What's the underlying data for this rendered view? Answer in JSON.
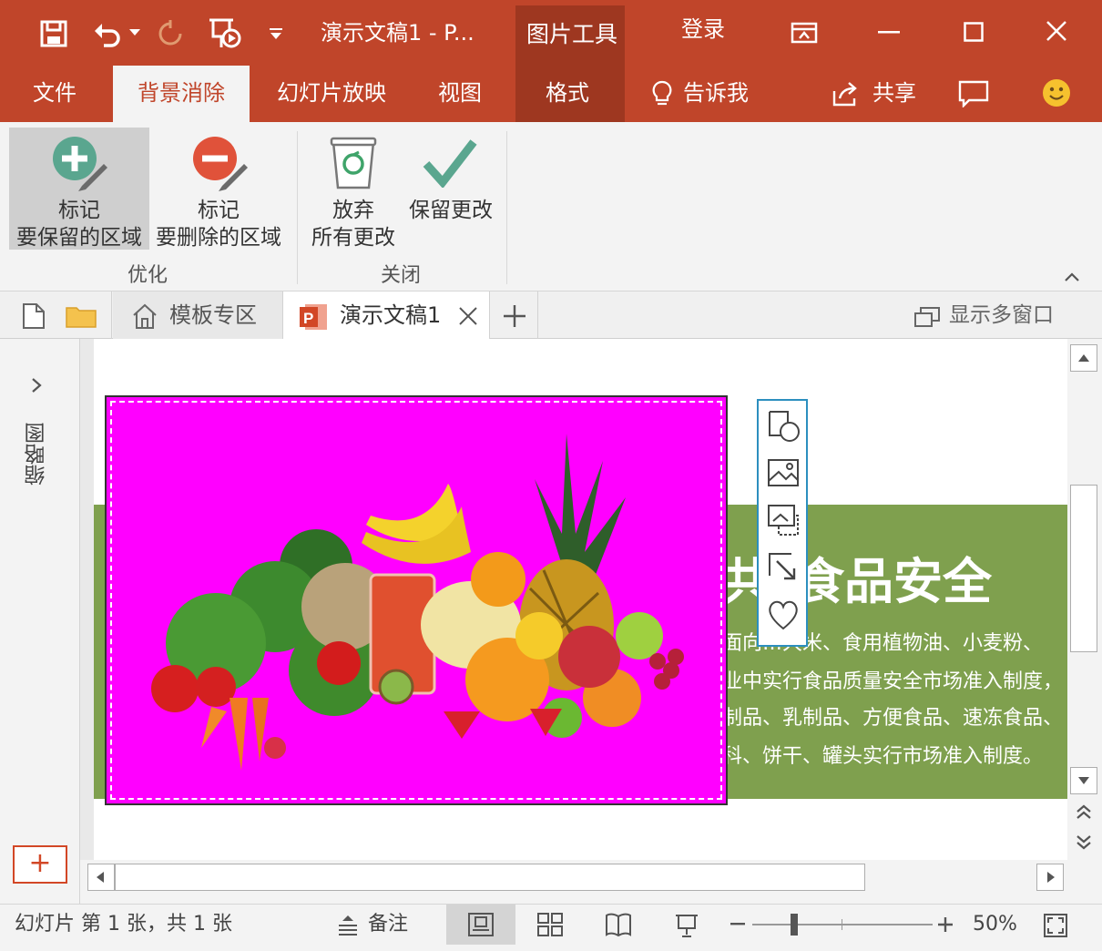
{
  "colors": {
    "brand": "#c0452a",
    "context_tab": "#9e3720",
    "picture_bg": "#ff00ff",
    "slide_band": "#7fa04e",
    "accent_green": "#5aa68f",
    "accent_red": "#e0523a"
  },
  "titlebar": {
    "doc_title": "演示文稿1 - P...",
    "context_title": "图片工具",
    "login": "登录",
    "icons": [
      "save-icon",
      "undo-icon",
      "redo-icon",
      "present-from-start-icon",
      "customize-qat-icon",
      "ribbon-display-icon",
      "minimize-icon",
      "maximize-icon",
      "close-icon"
    ]
  },
  "tabs": {
    "file": "文件",
    "active": "背景消除",
    "slideshow": "幻灯片放映",
    "view": "视图",
    "format": "格式",
    "tell_me": "告诉我",
    "share": "共享"
  },
  "ribbon": {
    "groups": [
      {
        "name": "优化",
        "buttons": [
          {
            "line1": "标记",
            "line2": "要保留的区域",
            "icon": "mark-keep-icon"
          },
          {
            "line1": "标记",
            "line2": "要删除的区域",
            "icon": "mark-remove-icon"
          }
        ]
      },
      {
        "name": "关闭",
        "buttons": [
          {
            "line1": "放弃",
            "line2": "所有更改",
            "icon": "discard-icon"
          },
          {
            "line1": "保留更改",
            "line2": "",
            "icon": "keep-changes-icon"
          }
        ]
      }
    ]
  },
  "doc_tabs": {
    "template": "模板专区",
    "active_doc": "演示文稿1",
    "multi_window": "显示多窗口"
  },
  "sidebar": {
    "label": "缩略图",
    "add": "+"
  },
  "slide": {
    "title_partial": "共",
    "title": "食品安全",
    "lines": [
      "面向…大米、食用植物油、小麦粉、",
      "业中实行食品质量安全市场准入制度，",
      "制品、乳制品、方便食品、速冻食品、",
      "科、饼干、罐头实行市场准入制度。"
    ]
  },
  "statusbar": {
    "slide_info": "幻灯片 第 1 张，共 1 张",
    "notes": "备注",
    "zoom": "50%"
  }
}
